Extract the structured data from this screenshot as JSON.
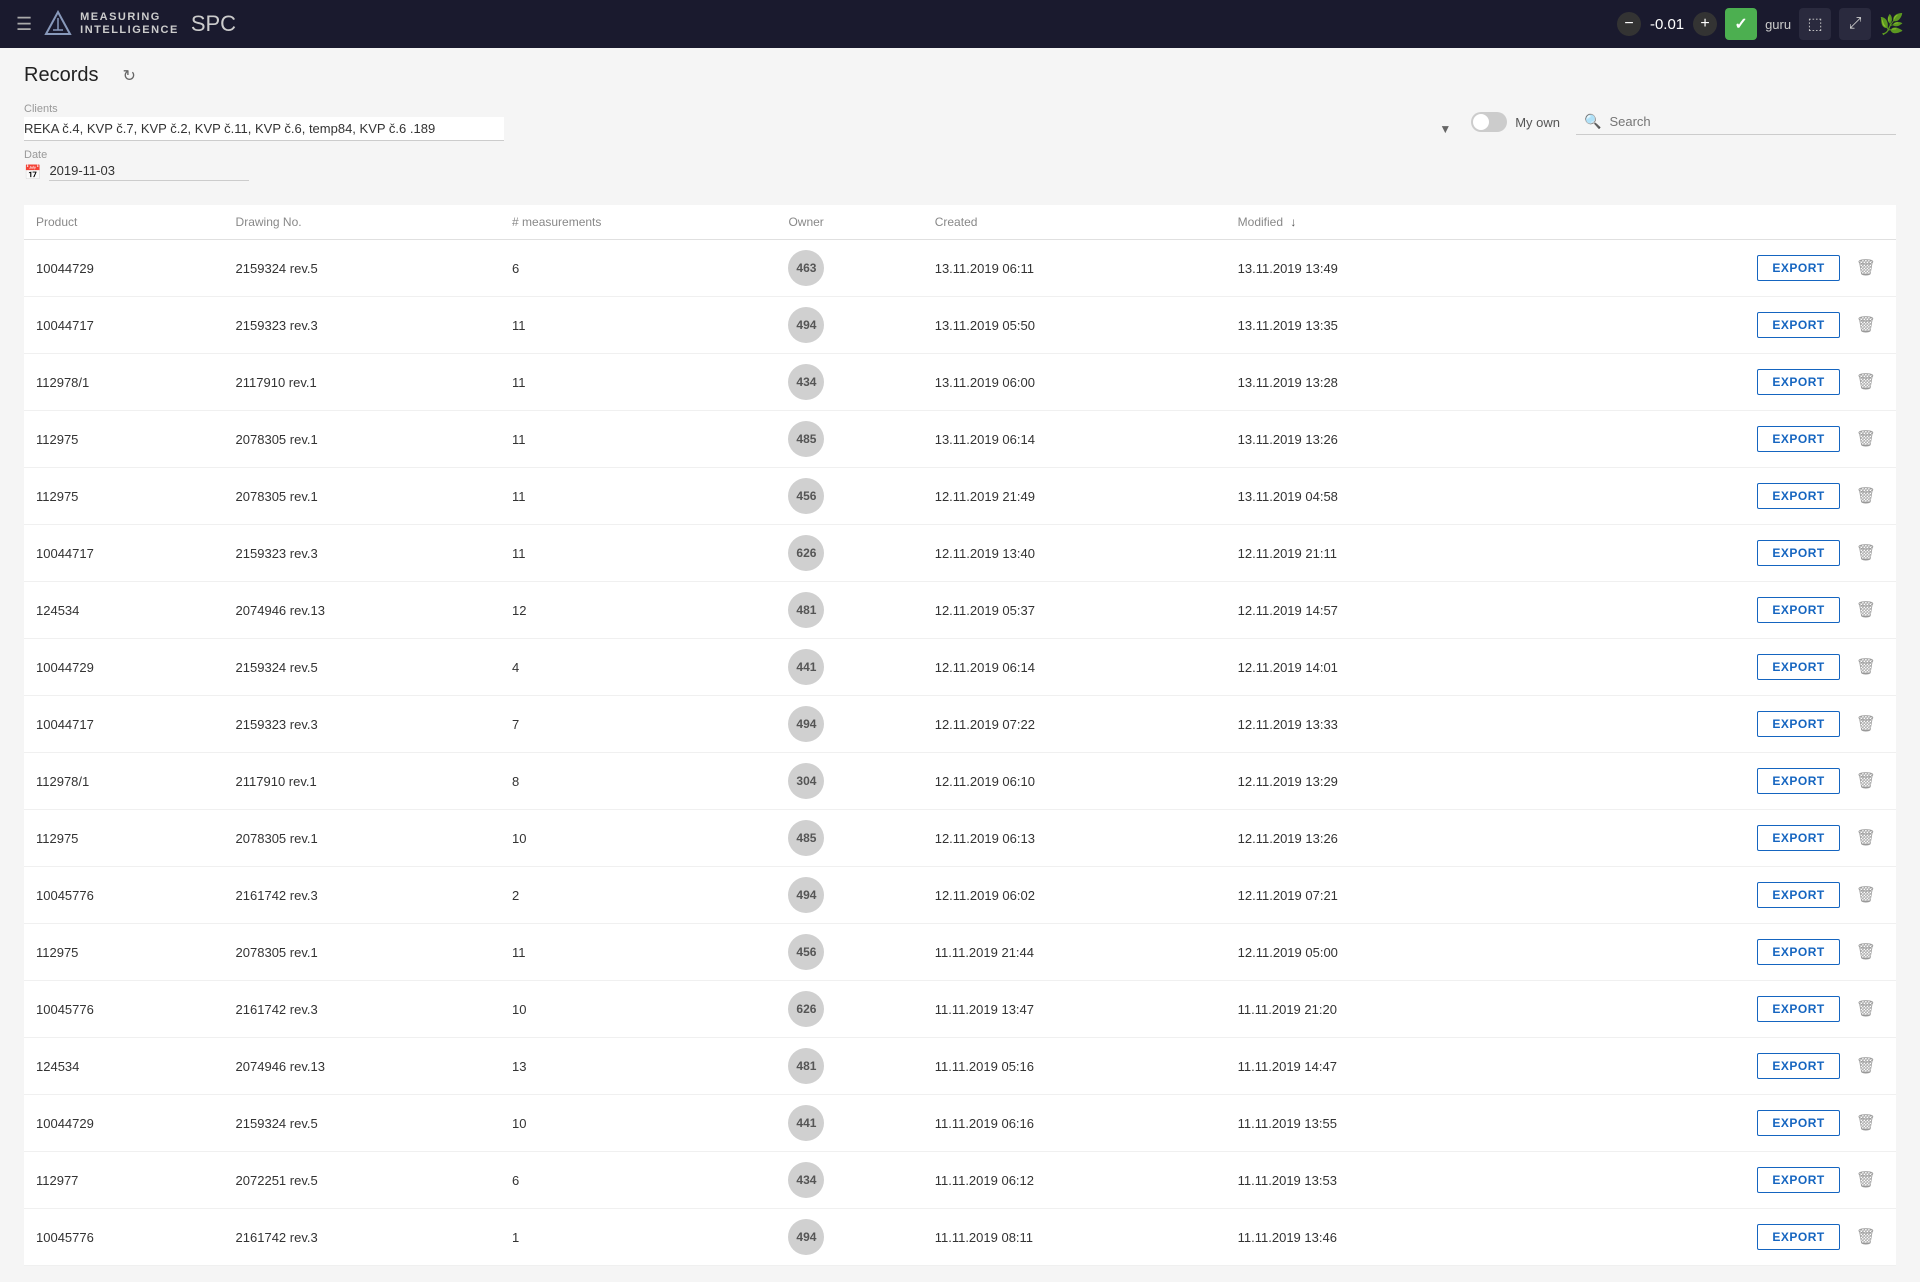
{
  "topnav": {
    "menu_icon": "☰",
    "logo_line1": "MEASURING",
    "logo_line2": "INTELLIGENCE",
    "spc_label": "SPC",
    "score_minus": "−",
    "score_value": "-0.01",
    "score_plus": "+",
    "check_icon": "✓",
    "user_label": "guru",
    "login_icon": "⬚",
    "expand_icon": "⤢",
    "leaf_icon": "🌿"
  },
  "page": {
    "title": "Records",
    "refresh_icon": "↻"
  },
  "clients": {
    "label": "Clients",
    "value": "REKA č.4, KVP č.7, KVP č.2, KVP č.11, KVP č.6, temp84, KVP č.6 .189"
  },
  "my_own": {
    "label": "My own",
    "enabled": false
  },
  "search": {
    "placeholder": "Search",
    "icon": "🔍"
  },
  "date": {
    "label": "Date",
    "value": "2019-11-03"
  },
  "table": {
    "columns": [
      {
        "key": "product",
        "label": "Product",
        "sortable": false
      },
      {
        "key": "drawing",
        "label": "Drawing No.",
        "sortable": false
      },
      {
        "key": "measurements",
        "label": "# measurements",
        "sortable": false
      },
      {
        "key": "owner",
        "label": "Owner",
        "sortable": false
      },
      {
        "key": "created",
        "label": "Created",
        "sortable": false
      },
      {
        "key": "modified",
        "label": "Modified ↓",
        "sortable": true
      }
    ],
    "rows": [
      {
        "product": "10044729",
        "drawing": "2159324 rev.5",
        "measurements": "6",
        "owner": "463",
        "created": "13.11.2019 06:11",
        "modified": "13.11.2019 13:49"
      },
      {
        "product": "10044717",
        "drawing": "2159323 rev.3",
        "measurements": "11",
        "owner": "494",
        "created": "13.11.2019 05:50",
        "modified": "13.11.2019 13:35"
      },
      {
        "product": "112978/1",
        "drawing": "2117910 rev.1",
        "measurements": "11",
        "owner": "434",
        "created": "13.11.2019 06:00",
        "modified": "13.11.2019 13:28"
      },
      {
        "product": "112975",
        "drawing": "2078305 rev.1",
        "measurements": "11",
        "owner": "485",
        "created": "13.11.2019 06:14",
        "modified": "13.11.2019 13:26"
      },
      {
        "product": "112975",
        "drawing": "2078305 rev.1",
        "measurements": "11",
        "owner": "456",
        "created": "12.11.2019 21:49",
        "modified": "13.11.2019 04:58"
      },
      {
        "product": "10044717",
        "drawing": "2159323 rev.3",
        "measurements": "11",
        "owner": "626",
        "created": "12.11.2019 13:40",
        "modified": "12.11.2019 21:11"
      },
      {
        "product": "124534",
        "drawing": "2074946 rev.13",
        "measurements": "12",
        "owner": "481",
        "created": "12.11.2019 05:37",
        "modified": "12.11.2019 14:57"
      },
      {
        "product": "10044729",
        "drawing": "2159324 rev.5",
        "measurements": "4",
        "owner": "441",
        "created": "12.11.2019 06:14",
        "modified": "12.11.2019 14:01"
      },
      {
        "product": "10044717",
        "drawing": "2159323 rev.3",
        "measurements": "7",
        "owner": "494",
        "created": "12.11.2019 07:22",
        "modified": "12.11.2019 13:33"
      },
      {
        "product": "112978/1",
        "drawing": "2117910 rev.1",
        "measurements": "8",
        "owner": "304",
        "created": "12.11.2019 06:10",
        "modified": "12.11.2019 13:29"
      },
      {
        "product": "112975",
        "drawing": "2078305 rev.1",
        "measurements": "10",
        "owner": "485",
        "created": "12.11.2019 06:13",
        "modified": "12.11.2019 13:26"
      },
      {
        "product": "10045776",
        "drawing": "2161742 rev.3",
        "measurements": "2",
        "owner": "494",
        "created": "12.11.2019 06:02",
        "modified": "12.11.2019 07:21"
      },
      {
        "product": "112975",
        "drawing": "2078305 rev.1",
        "measurements": "11",
        "owner": "456",
        "created": "11.11.2019 21:44",
        "modified": "12.11.2019 05:00"
      },
      {
        "product": "10045776",
        "drawing": "2161742 rev.3",
        "measurements": "10",
        "owner": "626",
        "created": "11.11.2019 13:47",
        "modified": "11.11.2019 21:20"
      },
      {
        "product": "124534",
        "drawing": "2074946 rev.13",
        "measurements": "13",
        "owner": "481",
        "created": "11.11.2019 05:16",
        "modified": "11.11.2019 14:47"
      },
      {
        "product": "10044729",
        "drawing": "2159324 rev.5",
        "measurements": "10",
        "owner": "441",
        "created": "11.11.2019 06:16",
        "modified": "11.11.2019 13:55"
      },
      {
        "product": "112977",
        "drawing": "2072251 rev.5",
        "measurements": "6",
        "owner": "434",
        "created": "11.11.2019 06:12",
        "modified": "11.11.2019 13:53"
      },
      {
        "product": "10045776",
        "drawing": "2161742 rev.3",
        "measurements": "1",
        "owner": "494",
        "created": "11.11.2019 08:11",
        "modified": "11.11.2019 13:46"
      }
    ],
    "export_label": "EXPORT"
  }
}
